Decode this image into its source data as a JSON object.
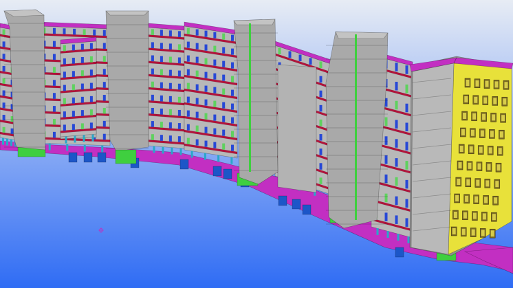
{
  "viewport": {
    "background_top": "#e7ecf4",
    "background_bottom": "#2f6cf4"
  },
  "colors": {
    "facade_gray": "#a9a9a9",
    "facade_gray_dark": "#8f8f8f",
    "facade_yellow": "#e8e13a",
    "roof_magenta": "#c22fc2",
    "balcony_red": "#b4123b",
    "footing_green": "#3fcf3f",
    "column_cyan": "#2aa7c8",
    "foundation_blue": "#1c56c8",
    "window_blue": "#2748d6",
    "window_green": "#5fd15f"
  },
  "icons": {
    "origin_marker": "coordinate-origin-icon"
  }
}
